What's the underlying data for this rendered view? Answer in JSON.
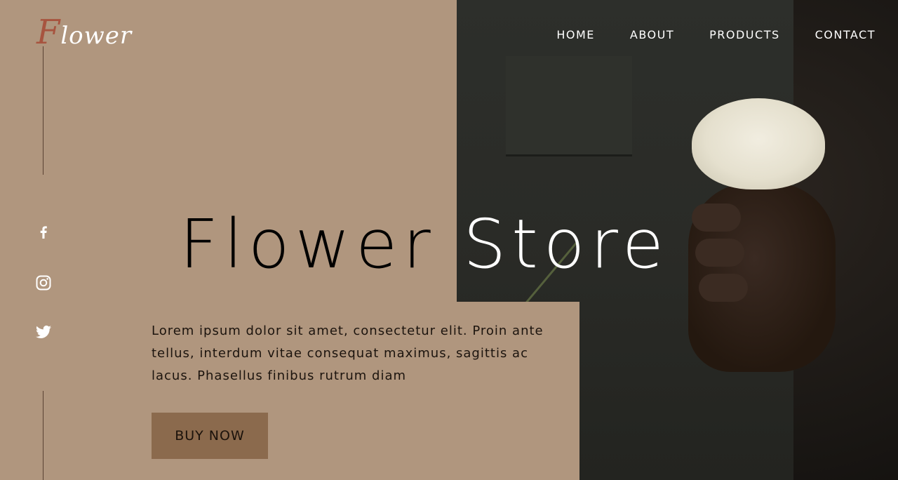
{
  "logo": {
    "first_letter": "F",
    "rest": "lower"
  },
  "nav": {
    "items": [
      {
        "label": "HOME"
      },
      {
        "label": "ABOUT"
      },
      {
        "label": "PRODUCTS"
      },
      {
        "label": "CONTACT"
      }
    ]
  },
  "social": [
    {
      "icon": "facebook-icon"
    },
    {
      "icon": "instagram-icon"
    },
    {
      "icon": "twitter-icon"
    }
  ],
  "hero": {
    "title_word_1": "Flower",
    "title_word_2": "Store",
    "description": "Lorem ipsum dolor sit amet, consectetur elit. Proin ante tellus, interdum vitae consequat maximus, sagittis ac lacus. Phasellus finibus rutrum diam",
    "button_label": "BUY NOW"
  },
  "colors": {
    "background": "#b0967e",
    "button": "#8b6a4d",
    "logo_accent": "#a7543f"
  }
}
